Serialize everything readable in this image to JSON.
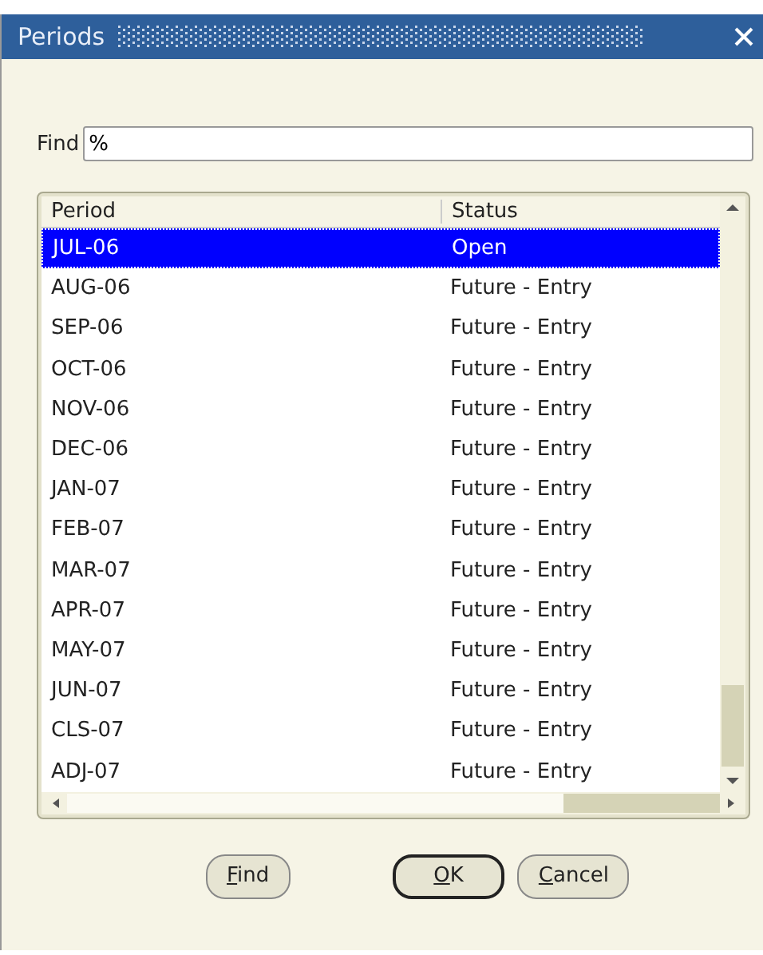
{
  "window": {
    "title": "Periods"
  },
  "find": {
    "label": "Find",
    "value": "%"
  },
  "table": {
    "columns": [
      "Period",
      "Status"
    ],
    "rows": [
      {
        "period": "JUL-06",
        "status": "Open",
        "selected": true
      },
      {
        "period": "AUG-06",
        "status": "Future - Entry",
        "selected": false
      },
      {
        "period": "SEP-06",
        "status": "Future - Entry",
        "selected": false
      },
      {
        "period": "OCT-06",
        "status": "Future - Entry",
        "selected": false
      },
      {
        "period": "NOV-06",
        "status": "Future - Entry",
        "selected": false
      },
      {
        "period": "DEC-06",
        "status": "Future - Entry",
        "selected": false
      },
      {
        "period": "JAN-07",
        "status": "Future - Entry",
        "selected": false
      },
      {
        "period": "FEB-07",
        "status": "Future - Entry",
        "selected": false
      },
      {
        "period": "MAR-07",
        "status": "Future - Entry",
        "selected": false
      },
      {
        "period": "APR-07",
        "status": "Future - Entry",
        "selected": false
      },
      {
        "period": "MAY-07",
        "status": "Future - Entry",
        "selected": false
      },
      {
        "period": "JUN-07",
        "status": "Future - Entry",
        "selected": false
      },
      {
        "period": "CLS-07",
        "status": "Future - Entry",
        "selected": false
      },
      {
        "period": "ADJ-07",
        "status": "Future - Entry",
        "selected": false
      }
    ]
  },
  "buttons": [
    {
      "label": "Find",
      "default": false
    },
    {
      "label": "OK",
      "default": true
    },
    {
      "label": "Cancel",
      "default": false
    }
  ]
}
